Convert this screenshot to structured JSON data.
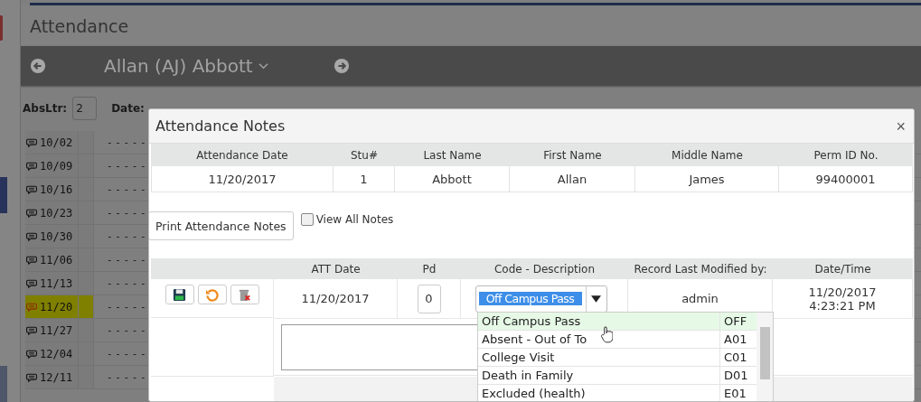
{
  "page": {
    "title": "Attendance",
    "student_name": "Allan (AJ) Abbott",
    "filters": [
      {
        "label": "AbsLtr:",
        "value": "2"
      },
      {
        "label": "Date:"
      }
    ],
    "weeks": [
      {
        "date": "10/02",
        "mark": "- - - - -",
        "highlighted": false
      },
      {
        "date": "10/09",
        "mark": "- - - - -",
        "highlighted": false
      },
      {
        "date": "10/16",
        "mark": "- - - - -",
        "highlighted": false
      },
      {
        "date": "10/23",
        "mark": "- - - - -",
        "highlighted": false
      },
      {
        "date": "10/30",
        "mark": "- - - - -",
        "highlighted": false
      },
      {
        "date": "11/06",
        "mark": "- - - - -",
        "highlighted": false
      },
      {
        "date": "11/13",
        "mark": "- - - - -",
        "highlighted": false
      },
      {
        "date": "11/20",
        "mark": "- - - - -",
        "highlighted": true
      },
      {
        "date": "11/27",
        "mark": "- - - - -",
        "highlighted": false
      },
      {
        "date": "12/04",
        "mark": "- - - - -",
        "highlighted": false
      },
      {
        "date": "12/11",
        "mark": "- - - - -",
        "highlighted": false
      }
    ]
  },
  "dialog": {
    "title": "Attendance Notes",
    "close": "×",
    "student_table": {
      "columns": [
        "Attendance Date",
        "Stu#",
        "Last Name",
        "First Name",
        "Middle Name",
        "Perm ID No."
      ],
      "row": [
        "11/20/2017",
        "1",
        "Abbott",
        "Allan",
        "James",
        "99400001"
      ]
    },
    "print_button": "Print Attendance Notes",
    "view_all": {
      "label": "View All Notes",
      "checked": false
    },
    "notes_table": {
      "columns": [
        "ATT Date",
        "Pd",
        "Code - Description",
        "Record Last Modified by:",
        "Date/Time"
      ],
      "row": {
        "att_date": "11/20/2017",
        "pd": "0",
        "code": "Off Campus Pass",
        "modified_by": "admin",
        "date_time": "11/20/2017 4:23:21 PM"
      }
    },
    "code_options": [
      {
        "label": "Off Campus Pass",
        "code": "OFF",
        "selected": true
      },
      {
        "label": "Absent - Out of To",
        "code": "A01",
        "selected": false
      },
      {
        "label": "College Visit",
        "code": "C01",
        "selected": false
      },
      {
        "label": "Death in Family",
        "code": "D01",
        "selected": false
      },
      {
        "label": "Excluded (health)",
        "code": "E01",
        "selected": false
      }
    ]
  }
}
